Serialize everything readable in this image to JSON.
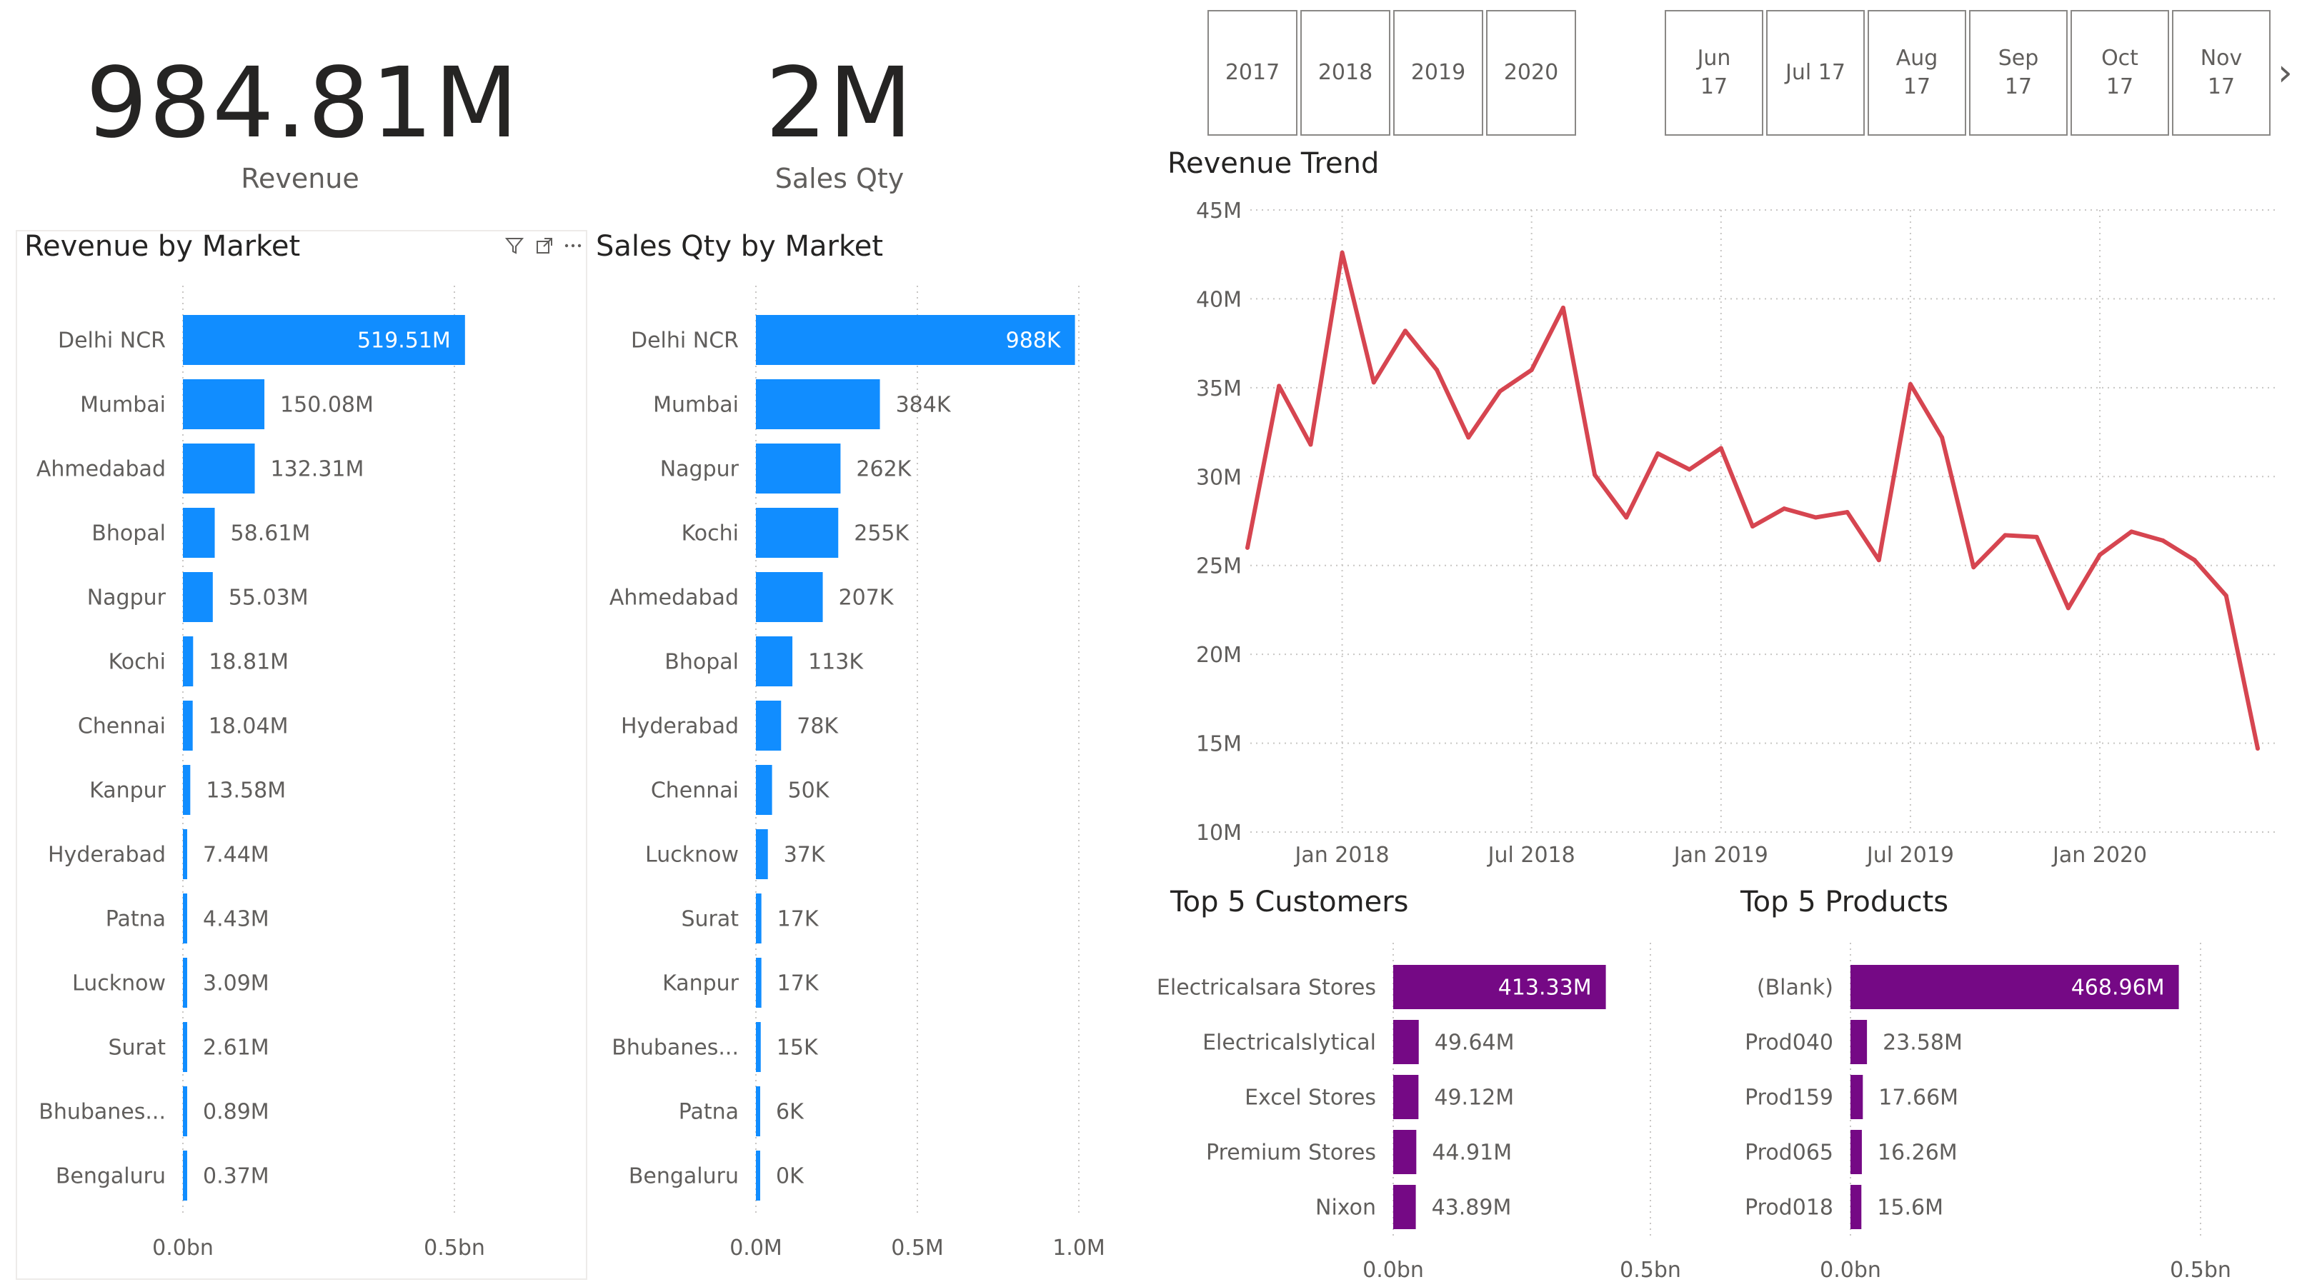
{
  "kpis": {
    "revenue": {
      "value": "984.81M",
      "label": "Revenue"
    },
    "sales_qty": {
      "value": "2M",
      "label": "Sales Qty"
    }
  },
  "slicers": {
    "years": [
      "2017",
      "2018",
      "2019",
      "2020"
    ],
    "months": [
      "Jun\n17",
      "Jul 17",
      "Aug\n17",
      "Sep\n17",
      "Oct\n17",
      "Nov\n17"
    ]
  },
  "visual_header_icons": [
    "filter-icon",
    "focus-mode-icon",
    "more-options-icon"
  ],
  "colors": {
    "blue": "#118dff",
    "red": "#d64550",
    "purple": "#750985"
  },
  "chart_data": [
    {
      "type": "bar",
      "orientation": "horizontal",
      "title": "Revenue by Market",
      "categories": [
        "Delhi NCR",
        "Mumbai",
        "Ahmedabad",
        "Bhopal",
        "Nagpur",
        "Kochi",
        "Chennai",
        "Kanpur",
        "Hyderabad",
        "Patna",
        "Lucknow",
        "Surat",
        "Bhubanes...",
        "Bengaluru"
      ],
      "values": [
        519.51,
        150.08,
        132.31,
        58.61,
        55.03,
        18.81,
        18.04,
        13.58,
        7.44,
        4.43,
        3.09,
        2.61,
        0.89,
        0.37
      ],
      "labels": [
        "519.51M",
        "150.08M",
        "132.31M",
        "58.61M",
        "55.03M",
        "18.81M",
        "18.04M",
        "13.58M",
        "7.44M",
        "4.43M",
        "3.09M",
        "2.61M",
        "0.89M",
        "0.37M"
      ],
      "unit": "M",
      "xlim": [
        0,
        500
      ],
      "xticks": [
        {
          "value": 0,
          "label": "0.0bn"
        },
        {
          "value": 500,
          "label": "0.5bn"
        }
      ],
      "grid": true,
      "color": "#118dff"
    },
    {
      "type": "bar",
      "orientation": "horizontal",
      "title": "Sales Qty by Market",
      "categories": [
        "Delhi NCR",
        "Mumbai",
        "Nagpur",
        "Kochi",
        "Ahmedabad",
        "Bhopal",
        "Hyderabad",
        "Chennai",
        "Lucknow",
        "Surat",
        "Kanpur",
        "Bhubanes...",
        "Patna",
        "Bengaluru"
      ],
      "values": [
        988,
        384,
        262,
        255,
        207,
        113,
        78,
        50,
        37,
        17,
        17,
        15,
        6,
        0
      ],
      "labels": [
        "988K",
        "384K",
        "262K",
        "255K",
        "207K",
        "113K",
        "78K",
        "50K",
        "37K",
        "17K",
        "17K",
        "15K",
        "6K",
        "0K"
      ],
      "unit": "K",
      "xlim": [
        0,
        1000
      ],
      "xticks": [
        {
          "value": 0,
          "label": "0.0M"
        },
        {
          "value": 500,
          "label": "0.5M"
        },
        {
          "value": 1000,
          "label": "1.0M"
        }
      ],
      "grid": true,
      "color": "#118dff"
    },
    {
      "type": "line",
      "title": "Revenue Trend",
      "x": [
        "2017-10",
        "2017-11",
        "2017-12",
        "2018-01",
        "2018-02",
        "2018-03",
        "2018-04",
        "2018-05",
        "2018-06",
        "2018-07",
        "2018-08",
        "2018-09",
        "2018-10",
        "2018-11",
        "2018-12",
        "2019-01",
        "2019-02",
        "2019-03",
        "2019-04",
        "2019-05",
        "2019-06",
        "2019-07",
        "2019-08",
        "2019-09",
        "2019-10",
        "2019-11",
        "2019-12",
        "2020-01",
        "2020-02",
        "2020-03",
        "2020-04",
        "2020-05",
        "2020-06"
      ],
      "values": [
        26.0,
        35.1,
        31.8,
        42.6,
        35.3,
        38.2,
        36.0,
        32.2,
        34.8,
        36.0,
        39.5,
        30.1,
        27.7,
        31.3,
        30.4,
        31.6,
        27.2,
        28.2,
        27.7,
        28.0,
        25.3,
        35.2,
        32.2,
        24.9,
        26.7,
        26.6,
        22.6,
        25.6,
        26.9,
        26.4,
        25.3,
        23.3,
        14.7
      ],
      "unit": "M",
      "ylim": [
        10,
        45
      ],
      "yticks": [
        "10M",
        "15M",
        "20M",
        "25M",
        "30M",
        "35M",
        "40M",
        "45M"
      ],
      "xticks": [
        {
          "x": "2018-01",
          "label": "Jan 2018"
        },
        {
          "x": "2018-07",
          "label": "Jul 2018"
        },
        {
          "x": "2019-01",
          "label": "Jan 2019"
        },
        {
          "x": "2019-07",
          "label": "Jul 2019"
        },
        {
          "x": "2020-01",
          "label": "Jan 2020"
        }
      ],
      "grid": true,
      "color": "#d64550"
    },
    {
      "type": "bar",
      "orientation": "horizontal",
      "title": "Top 5 Customers",
      "categories": [
        "Electricalsara Stores",
        "Electricalslytical",
        "Excel Stores",
        "Premium Stores",
        "Nixon"
      ],
      "values": [
        413.33,
        49.64,
        49.12,
        44.91,
        43.89
      ],
      "labels": [
        "413.33M",
        "49.64M",
        "49.12M",
        "44.91M",
        "43.89M"
      ],
      "unit": "M",
      "xlim": [
        0,
        500
      ],
      "xticks": [
        {
          "value": 0,
          "label": "0.0bn"
        },
        {
          "value": 500,
          "label": "0.5bn"
        }
      ],
      "grid": true,
      "color": "#750985"
    },
    {
      "type": "bar",
      "orientation": "horizontal",
      "title": "Top 5 Products",
      "categories": [
        "(Blank)",
        "Prod040",
        "Prod159",
        "Prod065",
        "Prod018"
      ],
      "values": [
        468.96,
        23.58,
        17.66,
        16.26,
        15.6
      ],
      "labels": [
        "468.96M",
        "23.58M",
        "17.66M",
        "16.26M",
        "15.6M"
      ],
      "unit": "M",
      "xlim": [
        0,
        500
      ],
      "xticks": [
        {
          "value": 0,
          "label": "0.0bn"
        },
        {
          "value": 500,
          "label": "0.5bn"
        }
      ],
      "grid": true,
      "color": "#750985"
    }
  ]
}
